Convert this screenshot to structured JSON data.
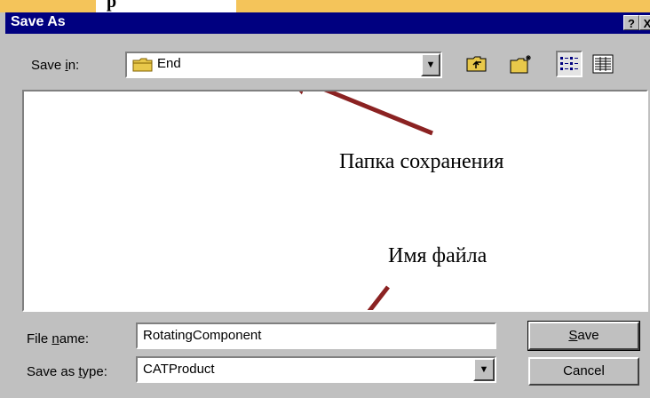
{
  "header_fragment": "p",
  "window": {
    "title": "Save As",
    "help_glyph": "?",
    "close_glyph": "X"
  },
  "save_in": {
    "label_pre": "Save ",
    "label_ul": "i",
    "label_post": "n:",
    "value": "End",
    "icon": "folder-icon"
  },
  "toolbar": {
    "up_icon": "up-one-level-icon",
    "new_folder_icon": "new-folder-icon",
    "list_icon": "list-view-icon",
    "details_icon": "details-view-icon"
  },
  "annotations": {
    "folder": "Папка сохранения",
    "filename": "Имя файла",
    "arrow_color": "#8b2222"
  },
  "file_name": {
    "label_pre": "File ",
    "label_ul": "n",
    "label_post": "ame:",
    "value": "RotatingComponent"
  },
  "save_as_type": {
    "label_pre": "Save as ",
    "label_ul": "t",
    "label_post": "ype:",
    "value": "CATProduct"
  },
  "buttons": {
    "save_ul": "S",
    "save_rest": "ave",
    "cancel": "Cancel"
  }
}
